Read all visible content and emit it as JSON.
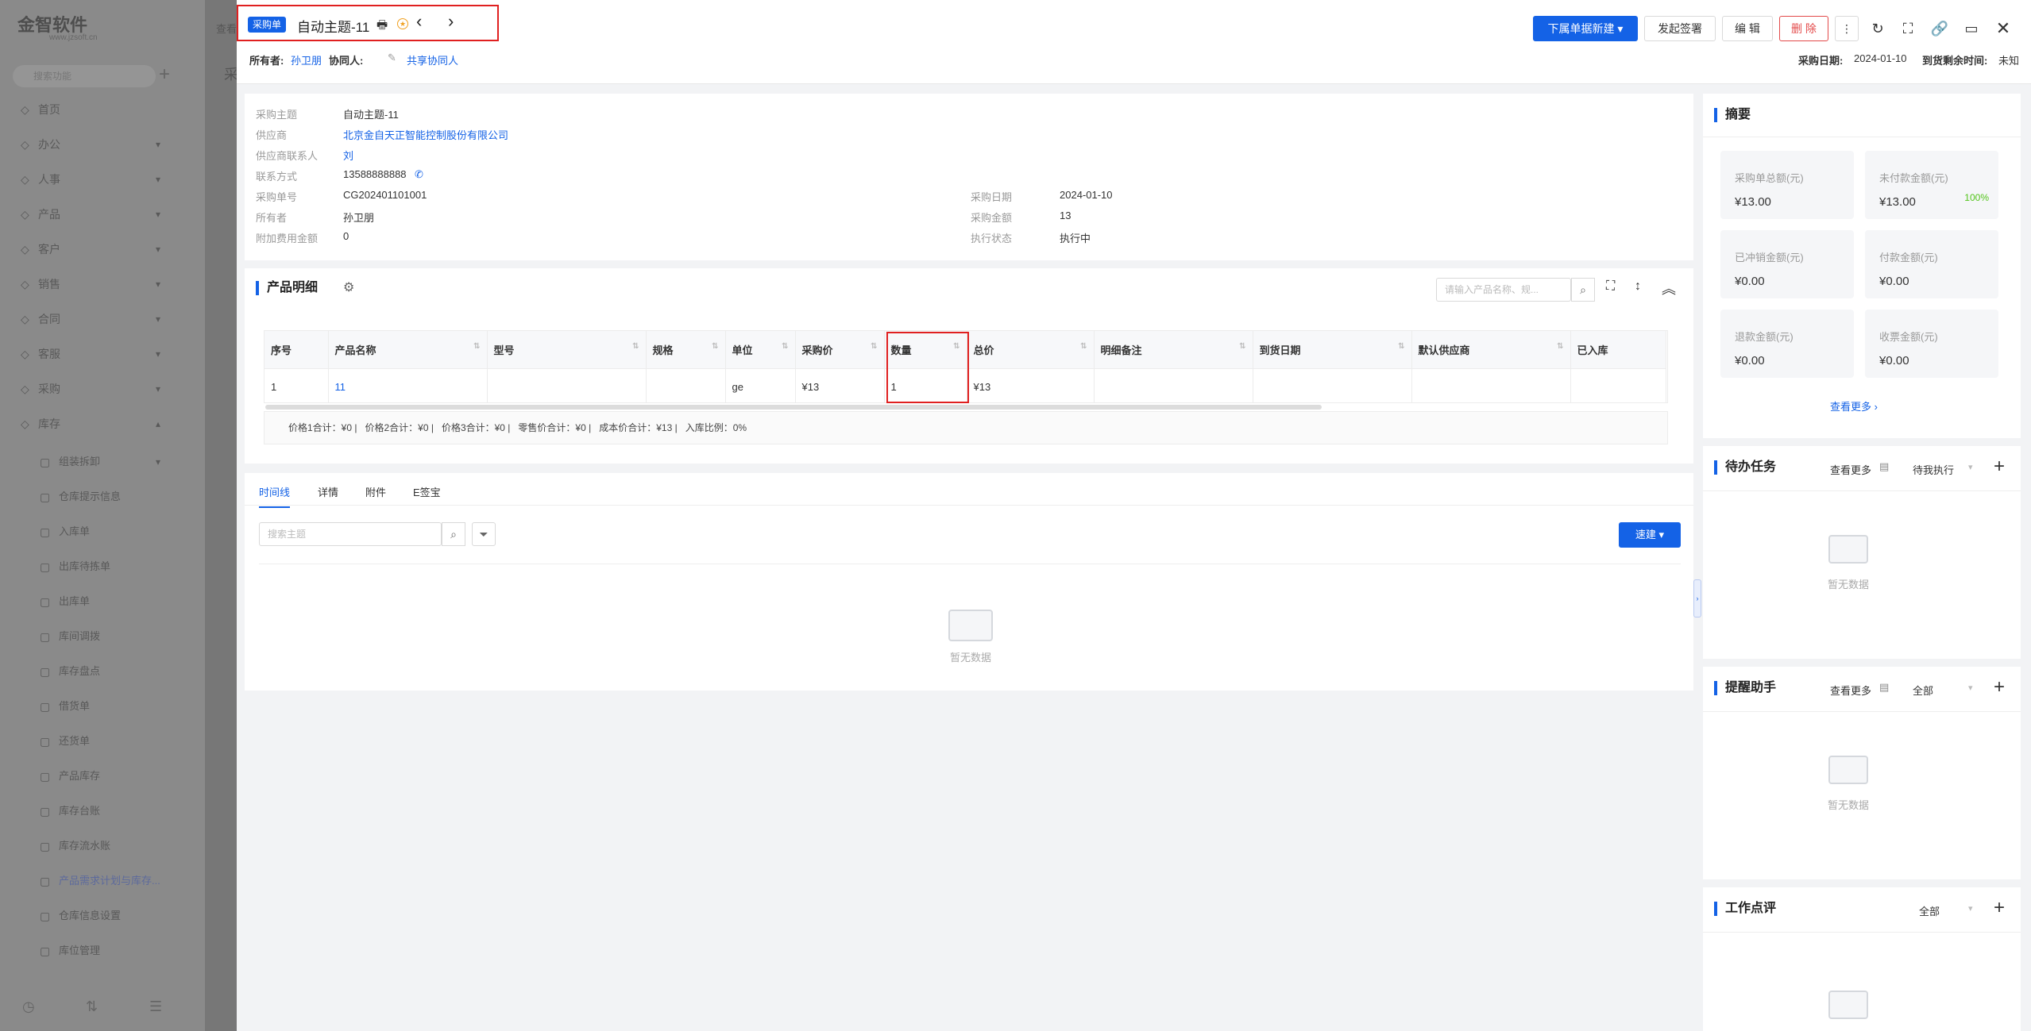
{
  "sidebar": {
    "logo": "金智软件",
    "logo_sub": "www.jzsoft.cn",
    "search_placeholder": "搜索功能",
    "items": [
      {
        "label": "首页",
        "icon": "home-icon"
      },
      {
        "label": "办公",
        "icon": "office-icon"
      },
      {
        "label": "人事",
        "icon": "user-icon"
      },
      {
        "label": "产品",
        "icon": "box-icon"
      },
      {
        "label": "客户",
        "icon": "customer-icon"
      },
      {
        "label": "销售",
        "icon": "sales-icon"
      },
      {
        "label": "合同",
        "icon": "contract-icon"
      },
      {
        "label": "客服",
        "icon": "service-icon"
      },
      {
        "label": "采购",
        "icon": "purchase-icon"
      },
      {
        "label": "库存",
        "icon": "stock-icon"
      }
    ],
    "sub_items": [
      "组装拆卸",
      "仓库提示信息",
      "入库单",
      "出库待拣单",
      "出库单",
      "库间调拨",
      "库存盘点",
      "借货单",
      "还货单",
      "产品库存",
      "库存台账",
      "库存流水账",
      "产品需求计划与库存...",
      "仓库信息设置",
      "库位管理"
    ]
  },
  "midstrip": {
    "text": "查看",
    "text2": "采"
  },
  "header": {
    "badge": "采购单",
    "title": "自动主题-11",
    "owner_label": "所有者:",
    "owner": "孙卫朋",
    "collab_label": "协同人:",
    "share_label": "共享协同人",
    "btn_new": "下属单据新建",
    "btn_sign": "发起签署",
    "btn_edit": "编 辑",
    "btn_delete": "删 除",
    "date_label": "采购日期:",
    "date": "2024-01-10",
    "remain_label": "到货剩余时间:",
    "remain": "未知"
  },
  "info": {
    "rows": [
      {
        "label": "采购主题",
        "value": "自动主题-11",
        "link": false
      },
      {
        "label": "供应商",
        "value": "北京金自天正智能控制股份有限公司",
        "link": true
      },
      {
        "label": "供应商联系人",
        "value": "刘",
        "link": true
      },
      {
        "label": "联系方式",
        "value": "13588888888",
        "link": false
      },
      {
        "label": "采购单号",
        "value": "CG202401101001",
        "link": false
      },
      {
        "label": "所有者",
        "value": "孙卫朋",
        "link": false
      },
      {
        "label": "附加费用金额",
        "value": "0",
        "link": false
      }
    ],
    "right": [
      {
        "label": "采购日期",
        "value": "2024-01-10"
      },
      {
        "label": "采购金额",
        "value": "13"
      },
      {
        "label": "执行状态",
        "value": "执行中"
      }
    ]
  },
  "products": {
    "title": "产品明细",
    "search_placeholder": "请输入产品名称、规...",
    "columns": [
      "序号",
      "产品名称",
      "型号",
      "规格",
      "单位",
      "采购价",
      "数量",
      "总价",
      "明细备注",
      "到货日期",
      "默认供应商",
      "已入库"
    ],
    "row": [
      "1",
      "11",
      "",
      "",
      "ge",
      "¥13",
      "1",
      "¥13",
      "",
      "",
      "",
      ""
    ],
    "summary": "价格1合计：¥0 |   价格2合计：¥0 |   价格3合计：¥0 |   零售价合计：¥0 |   成本价合计：¥13 |   入库比例：0%"
  },
  "tabs": [
    "时间线",
    "详情",
    "附件",
    "E签宝"
  ],
  "timeline": {
    "search_placeholder": "搜索主题",
    "quick_btn": "速建",
    "empty": "暂无数据"
  },
  "summary": {
    "title": "摘要",
    "stats": [
      {
        "label": "采购单总额(元)",
        "value": "¥13.00"
      },
      {
        "label": "未付款金额(元)",
        "value": "¥13.00",
        "extra": "100%"
      },
      {
        "label": "已冲销金额(元)",
        "value": "¥0.00"
      },
      {
        "label": "付款金额(元)",
        "value": "¥0.00"
      },
      {
        "label": "退款金额(元)",
        "value": "¥0.00"
      },
      {
        "label": "收票金额(元)",
        "value": "¥0.00"
      }
    ],
    "more": "查看更多"
  },
  "todo": {
    "title": "待办任务",
    "more": "查看更多",
    "filter": "待我执行",
    "empty": "暂无数据"
  },
  "reminder": {
    "title": "提醒助手",
    "more": "查看更多",
    "filter": "全部",
    "empty": "暂无数据"
  },
  "review": {
    "title": "工作点评",
    "filter": "全部"
  },
  "colors": {
    "primary": "#1462e6",
    "danger": "#e34a4a",
    "highlight": "#e02020",
    "success": "#52c41a"
  }
}
